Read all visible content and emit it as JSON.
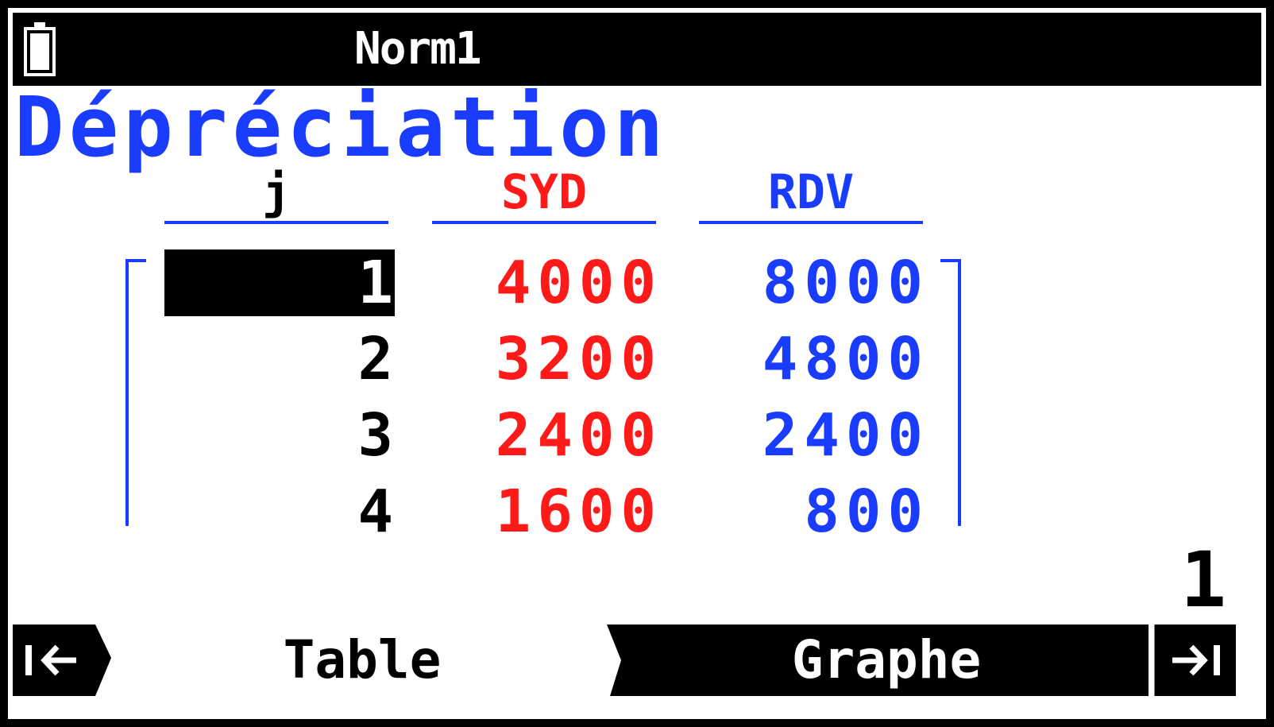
{
  "status_bar": {
    "mode": "Norm1",
    "battery_icon": "battery-icon"
  },
  "title": "Dépréciation",
  "table": {
    "headers": [
      "j",
      "SYD",
      "RDV"
    ],
    "rows": [
      {
        "j": "1",
        "syd": "4000",
        "rdv": "8000"
      },
      {
        "j": "2",
        "syd": "3200",
        "rdv": "4800"
      },
      {
        "j": "3",
        "syd": "2400",
        "rdv": "2400"
      },
      {
        "j": "4",
        "syd": "1600",
        "rdv": "800"
      }
    ],
    "selected_row": 0
  },
  "page_number": "1",
  "softkeys": {
    "prev_icon": "arrow-left-to-bar-icon",
    "table": "Table",
    "graphe": "Graphe",
    "next_icon": "arrow-right-to-bar-icon"
  },
  "colors": {
    "blue": "#1a3cff",
    "red": "#ff1a1a",
    "black": "#000000"
  }
}
